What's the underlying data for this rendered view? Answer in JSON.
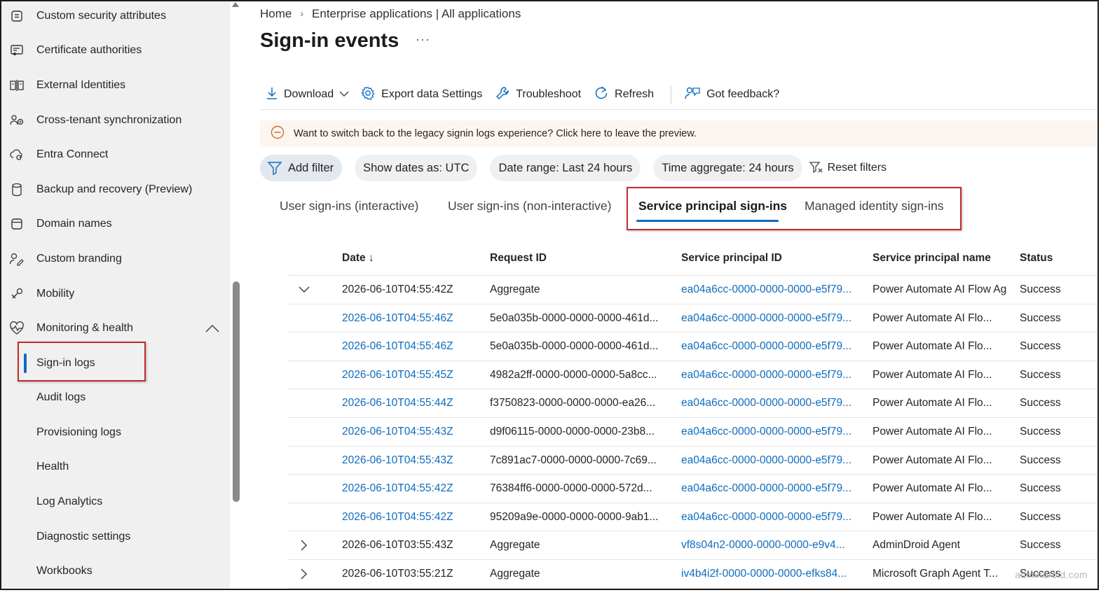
{
  "sidebar": {
    "items": [
      {
        "label": "Custom security attributes",
        "icon": "security-attributes-icon"
      },
      {
        "label": "Certificate authorities",
        "icon": "certificate-icon"
      },
      {
        "label": "External Identities",
        "icon": "external-identities-icon"
      },
      {
        "label": "Cross-tenant synchronization",
        "icon": "people-sync-icon"
      },
      {
        "label": "Entra Connect",
        "icon": "cloud-sync-icon"
      },
      {
        "label": "Backup and recovery (Preview)",
        "icon": "database-icon"
      },
      {
        "label": "Domain names",
        "icon": "domain-icon"
      },
      {
        "label": "Custom branding",
        "icon": "branding-icon"
      },
      {
        "label": "Mobility",
        "icon": "mobility-icon"
      },
      {
        "label": "Monitoring & health",
        "icon": "heart-pulse-icon"
      },
      {
        "label": "Sign-in logs"
      },
      {
        "label": "Audit logs"
      },
      {
        "label": "Provisioning logs"
      },
      {
        "label": "Health"
      },
      {
        "label": "Log Analytics"
      },
      {
        "label": "Diagnostic settings"
      },
      {
        "label": "Workbooks"
      }
    ],
    "active_item": "Sign-in logs"
  },
  "breadcrumb": [
    "Home",
    "Enterprise applications | All applications"
  ],
  "page": {
    "title": "Sign-in events",
    "more": "···"
  },
  "toolbar": {
    "download": "Download",
    "export": "Export data Settings",
    "troubleshoot": "Troubleshoot",
    "refresh": "Refresh",
    "feedback": "Got feedback?"
  },
  "banner": {
    "text": "Want to switch back to the legacy signin logs experience? Click here to leave the preview."
  },
  "filters": {
    "add": "Add filter",
    "dates": "Show dates as: UTC",
    "range": "Date range: Last 24 hours",
    "aggregate": "Time aggregate: 24 hours",
    "reset": "Reset filters"
  },
  "tabs": [
    "User sign-ins (interactive)",
    "User sign-ins (non-interactive)",
    "Service principal sign-ins",
    "Managed identity sign-ins"
  ],
  "active_tab": "Service principal sign-ins",
  "table": {
    "columns": [
      "Date ↓",
      "Request ID",
      "Service principal ID",
      "Service principal name",
      "Status"
    ],
    "rows": [
      {
        "expander": "down",
        "date": "2026-06-10T04:55:42Z",
        "date_link": false,
        "request_id": "Aggregate",
        "sp_id": "ea04a6cc-0000-0000-0000-e5f79...",
        "sp_name": "Power Automate AI Flow Ag",
        "status": "Success"
      },
      {
        "expander": "",
        "date": "2026-06-10T04:55:46Z",
        "date_link": true,
        "request_id": "5e0a035b-0000-0000-0000-461d...",
        "sp_id": "ea04a6cc-0000-0000-0000-e5f79...",
        "sp_name": "Power Automate AI Flo...",
        "status": "Success"
      },
      {
        "expander": "",
        "date": "2026-06-10T04:55:46Z",
        "date_link": true,
        "request_id": "5e0a035b-0000-0000-0000-461d...",
        "sp_id": "ea04a6cc-0000-0000-0000-e5f79...",
        "sp_name": "Power Automate AI Flo...",
        "status": "Success"
      },
      {
        "expander": "",
        "date": "2026-06-10T04:55:45Z",
        "date_link": true,
        "request_id": "4982a2ff-0000-0000-0000-5a8cc...",
        "sp_id": "ea04a6cc-0000-0000-0000-e5f79...",
        "sp_name": "Power Automate AI Flo...",
        "status": "Success"
      },
      {
        "expander": "",
        "date": "2026-06-10T04:55:44Z",
        "date_link": true,
        "request_id": "f3750823-0000-0000-0000-ea26...",
        "sp_id": "ea04a6cc-0000-0000-0000-e5f79...",
        "sp_name": "Power Automate AI Flo...",
        "status": "Success"
      },
      {
        "expander": "",
        "date": "2026-06-10T04:55:43Z",
        "date_link": true,
        "request_id": "d9f06115-0000-0000-0000-23b8...",
        "sp_id": "ea04a6cc-0000-0000-0000-e5f79...",
        "sp_name": "Power Automate AI Flo...",
        "status": "Success"
      },
      {
        "expander": "",
        "date": "2026-06-10T04:55:43Z",
        "date_link": true,
        "request_id": "7c891ac7-0000-0000-0000-7c69...",
        "sp_id": "ea04a6cc-0000-0000-0000-e5f79...",
        "sp_name": "Power Automate AI Flo...",
        "status": "Success"
      },
      {
        "expander": "",
        "date": "2026-06-10T04:55:42Z",
        "date_link": true,
        "request_id": "76384ff6-0000-0000-0000-572d...",
        "sp_id": "ea04a6cc-0000-0000-0000-e5f79...",
        "sp_name": "Power Automate AI Flo...",
        "status": "Success"
      },
      {
        "expander": "",
        "date": "2026-06-10T04:55:42Z",
        "date_link": true,
        "request_id": "95209a9e-0000-0000-0000-9ab1...",
        "sp_id": "ea04a6cc-0000-0000-0000-e5f79...",
        "sp_name": "Power Automate AI Flo...",
        "status": "Success"
      },
      {
        "expander": "right",
        "date": "2026-06-10T03:55:43Z",
        "date_link": false,
        "request_id": "Aggregate",
        "sp_id": "vf8s04n2-0000-0000-0000-e9v4...",
        "sp_name": "AdminDroid Agent",
        "status": "Success"
      },
      {
        "expander": "right",
        "date": "2026-06-10T03:55:21Z",
        "date_link": false,
        "request_id": "Aggregate",
        "sp_id": "iv4b4i2f-0000-0000-0000-efks84...",
        "sp_name": "Microsoft Graph Agent T...",
        "status": "Success"
      }
    ]
  },
  "watermark": "admindroid.com",
  "colors": {
    "accent": "#0f6cbd",
    "highlight_box": "#c42b2b",
    "banner_bg": "#fdf6f0",
    "warning": "#d06b2c"
  }
}
